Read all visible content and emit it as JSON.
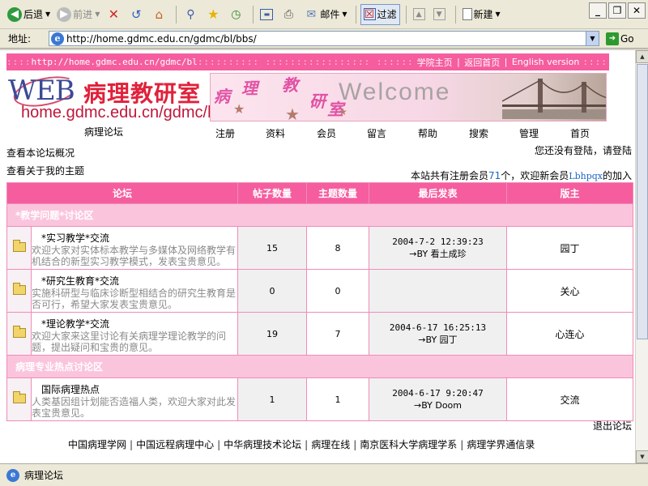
{
  "browser": {
    "toolbar": {
      "back": "后退",
      "forward": "前进",
      "mail": "邮件",
      "filter": "过滤",
      "new": "新建"
    },
    "address": {
      "label": "地址:",
      "url": "http://home.gdmc.edu.cn/gdmc/bl/bbs/",
      "go": "Go"
    },
    "status": {
      "text": "病理论坛"
    }
  },
  "page": {
    "topnav": {
      "url": "http://home.gdmc.edu.cn/gdmc/bl",
      "links": [
        "学院主页",
        "返回首页",
        "English version"
      ]
    },
    "logo": {
      "web": "WEB",
      "name": "病理教研室",
      "url": "home.gdmc.edu.cn/gdmc/bl"
    },
    "banner": {
      "chars": [
        "病",
        "理",
        "教",
        "研",
        "室"
      ],
      "welcome": "Welcome"
    },
    "forum_title": "病理论坛",
    "menu": [
      "注册",
      "资料",
      "会员",
      "留言",
      "帮助",
      "搜索",
      "管理",
      "首页"
    ],
    "info": {
      "overview": "查看本论坛概况",
      "my_topics": "查看关于我的主题",
      "login_status": "您还没有登陆，请登陆",
      "members_prefix": "本站共有注册会员",
      "member_count": "71",
      "members_mid": "个，欢迎新会员",
      "new_member": "Lbhpqx",
      "members_suffix": "的加入"
    },
    "table": {
      "headers": [
        "论坛",
        "帖子数量",
        "主题数量",
        "最后发表",
        "版主"
      ],
      "categories": [
        {
          "title": "*教学问题*讨论区",
          "forums": [
            {
              "name": "*实习教学*交流",
              "desc": "欢迎大家对实体标本教学与多媒体及网络教学有机结合的新型实习教学模式，发表宝贵意见。",
              "posts": "15",
              "topics": "8",
              "last_time": "2004-7-2 12:39:23",
              "last_by": "→BY 看土成珍",
              "moderator": "园丁"
            },
            {
              "name": "*研究生教育*交流",
              "desc": "实施科研型与临床诊断型相结合的研究生教育是否可行，希望大家发表宝贵意见。",
              "posts": "0",
              "topics": "0",
              "last_time": "",
              "last_by": "",
              "moderator": "关心"
            },
            {
              "name": "*理论教学*交流",
              "desc": "欢迎大家来这里讨论有关病理学理论教学的问题，提出疑问和宝贵的意见。",
              "posts": "19",
              "topics": "7",
              "last_time": "2004-6-17 16:25:13",
              "last_by": "→BY 园丁",
              "moderator": "心连心"
            }
          ]
        },
        {
          "title": "病理专业热点讨论区",
          "forums": [
            {
              "name": "国际病理热点",
              "desc": "人类基因组计划能否造福人类，欢迎大家对此发表宝贵意见。",
              "posts": "1",
              "topics": "1",
              "last_time": "2004-6-17 9:20:47",
              "last_by": "→BY Doom",
              "moderator": "交流"
            }
          ]
        }
      ]
    },
    "logout": "退出论坛",
    "footer_links": [
      "中国病理学网",
      "中国远程病理中心",
      "中华病理技术论坛",
      "病理在线",
      "南京医科大学病理学系",
      "病理学界通信录"
    ]
  }
}
